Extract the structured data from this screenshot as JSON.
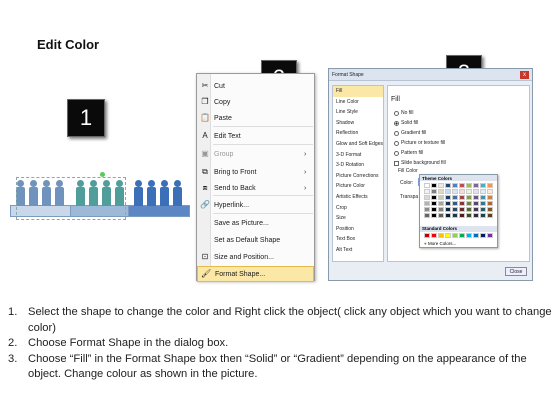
{
  "title": "Edit Color",
  "badges": [
    "1",
    "2",
    "3"
  ],
  "context_menu": {
    "items": [
      {
        "label": "Cut",
        "icon": "scissors-icon",
        "glyph": "✂"
      },
      {
        "label": "Copy",
        "icon": "copy-icon",
        "glyph": "❐"
      },
      {
        "label": "Paste",
        "icon": "paste-icon",
        "glyph": "📋"
      },
      {
        "label": "Edit Text",
        "icon": "edit-text-icon",
        "glyph": "A"
      },
      {
        "label": "Group",
        "icon": "group-icon",
        "glyph": "▣",
        "disabled": true,
        "submenu": true
      },
      {
        "label": "Bring to Front",
        "icon": "bring-front-icon",
        "glyph": "⧉",
        "submenu": true
      },
      {
        "label": "Send to Back",
        "icon": "send-back-icon",
        "glyph": "⧈",
        "submenu": true
      },
      {
        "label": "Hyperlink...",
        "icon": "hyperlink-icon",
        "glyph": "🔗"
      },
      {
        "label": "Save as Picture...",
        "icon": "",
        "glyph": ""
      },
      {
        "label": "Set as Default Shape",
        "icon": "",
        "glyph": ""
      },
      {
        "label": "Size and Position...",
        "icon": "size-icon",
        "glyph": "⊡"
      },
      {
        "label": "Format Shape...",
        "icon": "format-shape-icon",
        "glyph": "🖌",
        "highlighted": true
      }
    ]
  },
  "dialog": {
    "title": "Format Shape",
    "close_x": "x",
    "nav": [
      "Fill",
      "Line Color",
      "Line Style",
      "Shadow",
      "Reflection",
      "Glow and Soft Edges",
      "3-D Format",
      "3-D Rotation",
      "Picture Corrections",
      "Picture Color",
      "Artistic Effects",
      "Crop",
      "Size",
      "Position",
      "Text Box",
      "Alt Text"
    ],
    "pane_heading": "Fill",
    "fill_options": [
      "No fill",
      "Solid fill",
      "Gradient fill",
      "Picture or texture fill",
      "Pattern fill"
    ],
    "slide_bg": "Slide background fill",
    "fill_color_label": "Fill Color",
    "color_label": "Color:",
    "transparency_label": "Transpa",
    "close_button": "Close"
  },
  "palette": {
    "theme_header": "Theme Colors",
    "standard_header": "Standard Colors",
    "more_colors": "More Colors...",
    "theme_top": [
      "#ffffff",
      "#000000",
      "#eeece1",
      "#1f497d",
      "#4f81bd",
      "#c0504d",
      "#9bbb59",
      "#8064a2",
      "#4bacc6",
      "#f79646"
    ],
    "theme_shades": [
      "#f2f2f2",
      "#7f7f7f",
      "#ddd9c3",
      "#c6d9f0",
      "#dbe5f1",
      "#f2dcdb",
      "#ebf1dd",
      "#e5e0ec",
      "#dbeef3",
      "#fdeada"
    ],
    "standard": [
      "#c00000",
      "#ff0000",
      "#ffc000",
      "#ffff00",
      "#92d050",
      "#00b050",
      "#00b0f0",
      "#0070c0",
      "#002060",
      "#7030a0"
    ]
  },
  "instructions": [
    {
      "num": "1.",
      "text": "Select the shape to change the color and Right click the object( click any object which you want to change color)"
    },
    {
      "num": "2.",
      "text": "Choose Format Shape in the dialog box."
    },
    {
      "num": "3.",
      "text": "Choose “Fill” in the Format Shape box then “Solid” or “Gradient” depending on the appearance of the object. Change colour as shown in the picture."
    }
  ]
}
